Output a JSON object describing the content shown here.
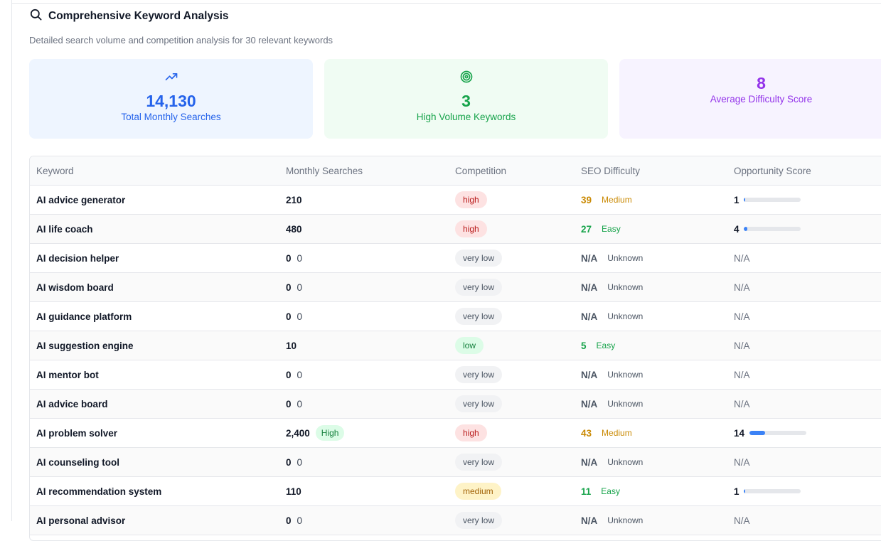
{
  "header": {
    "title": "Comprehensive Keyword Analysis",
    "subtitle": "Detailed search volume and competition analysis for 30 relevant keywords"
  },
  "stats": {
    "total": {
      "value": "14,130",
      "label": "Total Monthly Searches",
      "icon": "trending-up-icon"
    },
    "high_volume": {
      "value": "3",
      "label": "High Volume Keywords",
      "icon": "target-icon"
    },
    "difficulty": {
      "value": "8",
      "label": "Average Difficulty Score"
    }
  },
  "table": {
    "headers": {
      "keyword": "Keyword",
      "searches": "Monthly Searches",
      "competition": "Competition",
      "difficulty": "SEO Difficulty",
      "opportunity": "Opportunity Score"
    },
    "rows": [
      {
        "keyword": "AI advice generator",
        "searches": "210",
        "competition": "high",
        "difficulty": "39",
        "difficulty_label": "Medium",
        "opportunity": "1",
        "opportunity_fraction": 0.02
      },
      {
        "keyword": "AI life coach",
        "searches": "480",
        "competition": "high",
        "difficulty": "27",
        "difficulty_label": "Easy",
        "opportunity": "4",
        "opportunity_fraction": 0.06
      },
      {
        "keyword": "AI decision helper",
        "searches": "0",
        "searches_extra": "0",
        "competition": "very low",
        "difficulty": "N/A",
        "difficulty_label": "Unknown",
        "opportunity": "N/A"
      },
      {
        "keyword": "AI wisdom board",
        "searches": "0",
        "searches_extra": "0",
        "competition": "very low",
        "difficulty": "N/A",
        "difficulty_label": "Unknown",
        "opportunity": "N/A"
      },
      {
        "keyword": "AI guidance platform",
        "searches": "0",
        "searches_extra": "0",
        "competition": "very low",
        "difficulty": "N/A",
        "difficulty_label": "Unknown",
        "opportunity": "N/A"
      },
      {
        "keyword": "AI suggestion engine",
        "searches": "10",
        "competition": "low",
        "difficulty": "5",
        "difficulty_label": "Easy",
        "opportunity": "N/A"
      },
      {
        "keyword": "AI mentor bot",
        "searches": "0",
        "searches_extra": "0",
        "competition": "very low",
        "difficulty": "N/A",
        "difficulty_label": "Unknown",
        "opportunity": "N/A"
      },
      {
        "keyword": "AI advice board",
        "searches": "0",
        "searches_extra": "0",
        "competition": "very low",
        "difficulty": "N/A",
        "difficulty_label": "Unknown",
        "opportunity": "N/A"
      },
      {
        "keyword": "AI problem solver",
        "searches": "2,400",
        "volume_badge": "High",
        "competition": "high",
        "difficulty": "43",
        "difficulty_label": "Medium",
        "opportunity": "14",
        "opportunity_fraction": 0.28
      },
      {
        "keyword": "AI counseling tool",
        "searches": "0",
        "searches_extra": "0",
        "competition": "very low",
        "difficulty": "N/A",
        "difficulty_label": "Unknown",
        "opportunity": "N/A"
      },
      {
        "keyword": "AI recommendation system",
        "searches": "110",
        "competition": "medium",
        "difficulty": "11",
        "difficulty_label": "Easy",
        "opportunity": "1",
        "opportunity_fraction": 0.02
      },
      {
        "keyword": "AI personal advisor",
        "searches": "0",
        "searches_extra": "0",
        "competition": "very low",
        "difficulty": "N/A",
        "difficulty_label": "Unknown",
        "opportunity": "N/A"
      }
    ]
  },
  "colors": {
    "blue": "#2563eb",
    "green": "#16a34a",
    "purple": "#9333ea",
    "amber": "#ca8a04",
    "red": "#b91c1c"
  }
}
